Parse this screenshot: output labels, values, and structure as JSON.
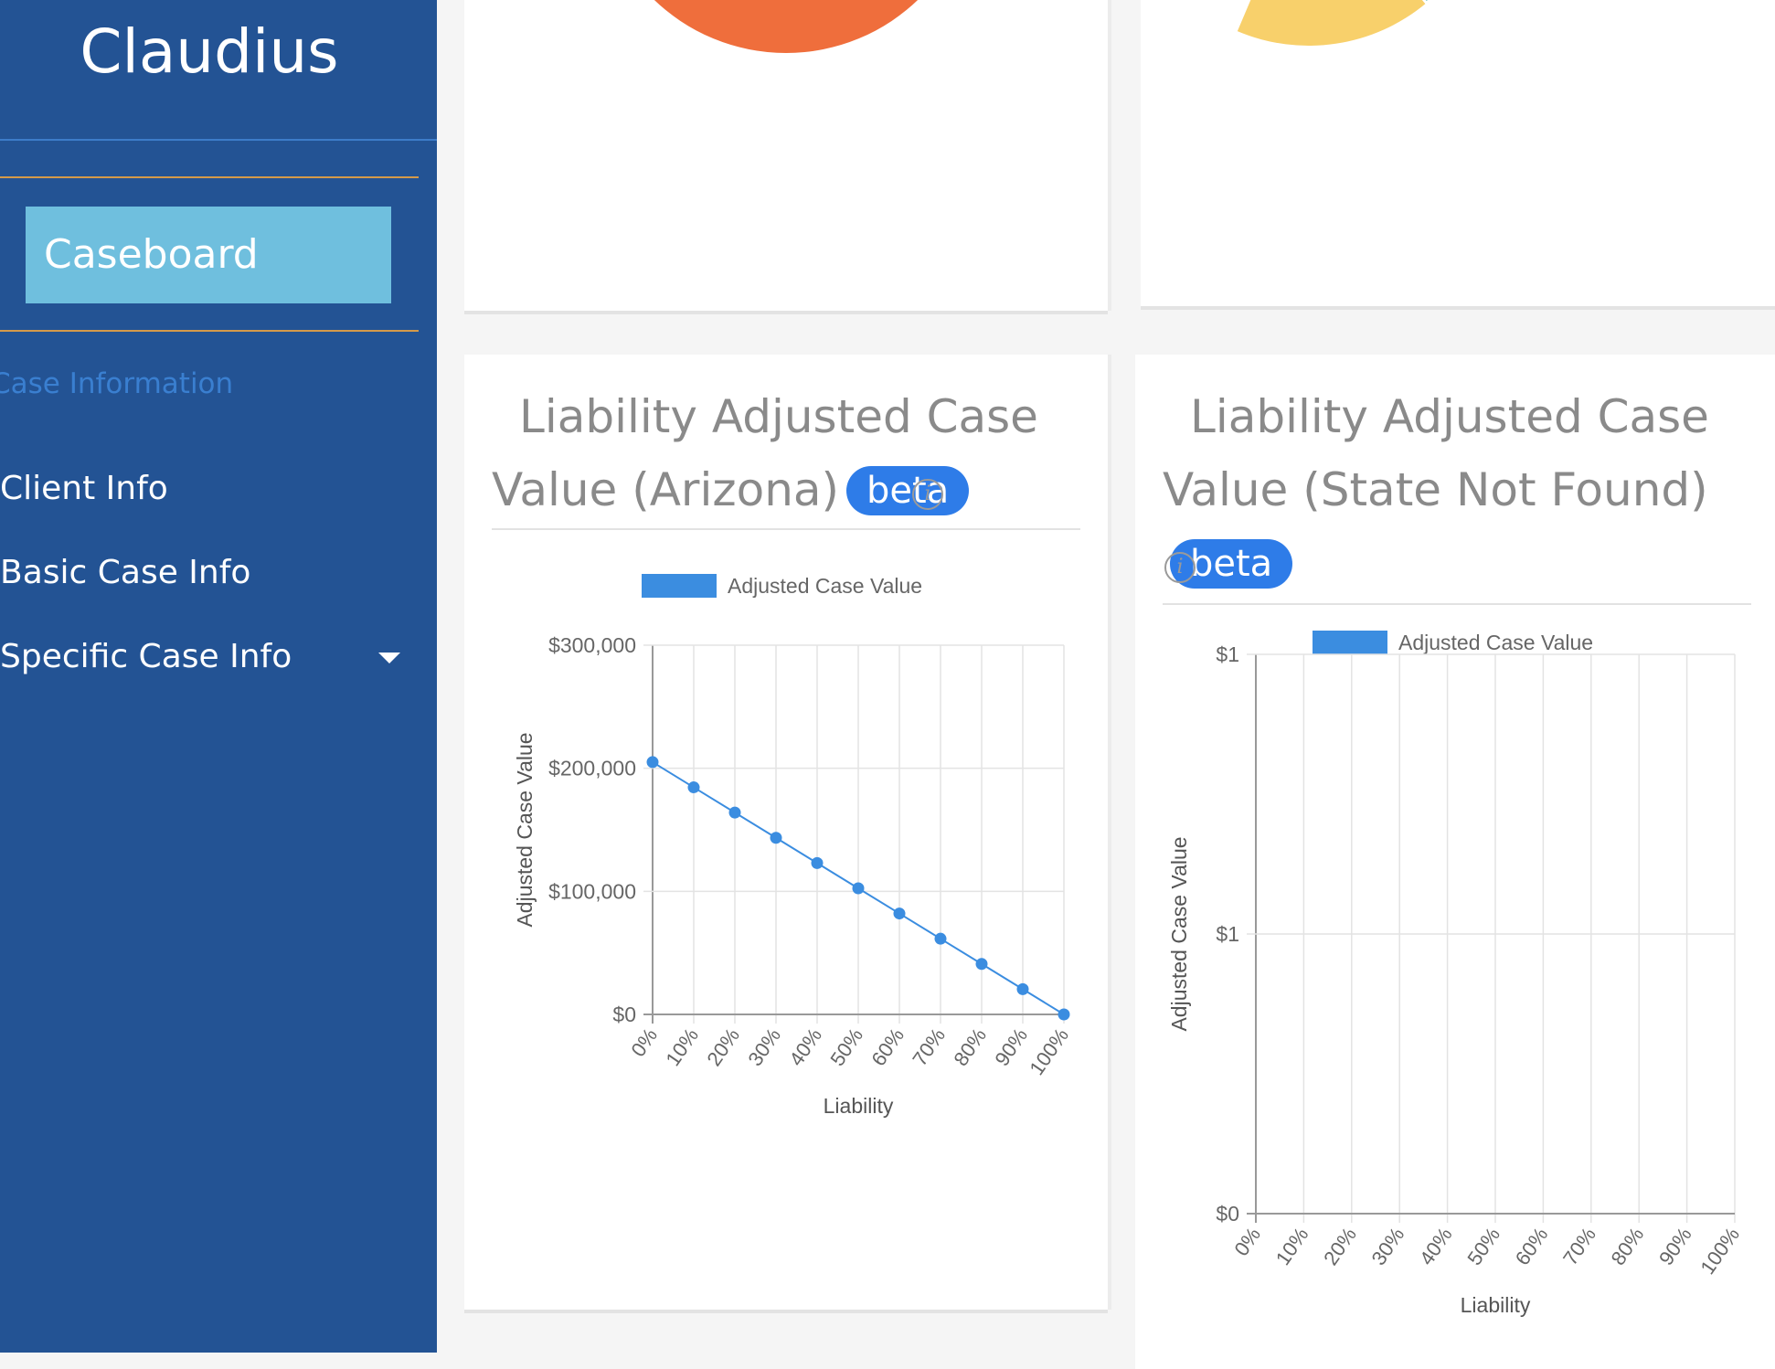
{
  "sidebar": {
    "brand": "Claudius",
    "active_item": "Caseboard",
    "section_header": "Case Information",
    "items": [
      {
        "label": "Client Info"
      },
      {
        "label": "Basic Case Info"
      },
      {
        "label": "Specific Case Info",
        "has_submenu": true
      }
    ]
  },
  "cards": [
    {
      "title_line1": "Liability Adjusted Case",
      "title_line2": "Value (Arizona)",
      "badge": "beta",
      "info": "i"
    },
    {
      "title_line1": "Liability Adjusted Case",
      "title_line2": "Value (State Not Found)",
      "badge": "beta",
      "info": "i"
    }
  ],
  "chart_data": [
    {
      "type": "line",
      "legend": "Adjusted Case Value",
      "legend_position": "top",
      "xlabel": "Liability",
      "ylabel": "Adjusted Case Value",
      "categories": [
        "0%",
        "10%",
        "20%",
        "30%",
        "40%",
        "50%",
        "60%",
        "70%",
        "80%",
        "90%",
        "100%"
      ],
      "y_ticks": [
        "$300,000",
        "$200,000",
        "$100,000",
        "$0"
      ],
      "ylim": [
        0,
        300000
      ],
      "series": [
        {
          "name": "Adjusted Case Value",
          "color": "#3b8de0",
          "values": [
            205000,
            184500,
            164000,
            143500,
            123000,
            102500,
            82000,
            61500,
            41000,
            20500,
            0
          ]
        }
      ],
      "grid": true
    },
    {
      "type": "line",
      "legend": "Adjusted Case Value",
      "legend_position": "top",
      "xlabel": "Liability",
      "ylabel": "Adjusted Case Value",
      "categories": [
        "0%",
        "10%",
        "20%",
        "30%",
        "40%",
        "50%",
        "60%",
        "70%",
        "80%",
        "90%",
        "100%"
      ],
      "y_ticks": [
        "$1",
        "$1",
        "$0"
      ],
      "ylim": [
        0,
        1
      ],
      "series": [
        {
          "name": "Adjusted Case Value",
          "color": "#3b8de0",
          "values": []
        }
      ],
      "grid": true
    }
  ],
  "pies": {
    "left": {
      "slices": [
        {
          "color": "#ef6e3c"
        }
      ]
    },
    "right": {
      "slices": [
        {
          "color": "#f8d06b"
        },
        {
          "color": "#72c6c2"
        },
        {
          "color": "#f47a8b"
        }
      ]
    }
  }
}
